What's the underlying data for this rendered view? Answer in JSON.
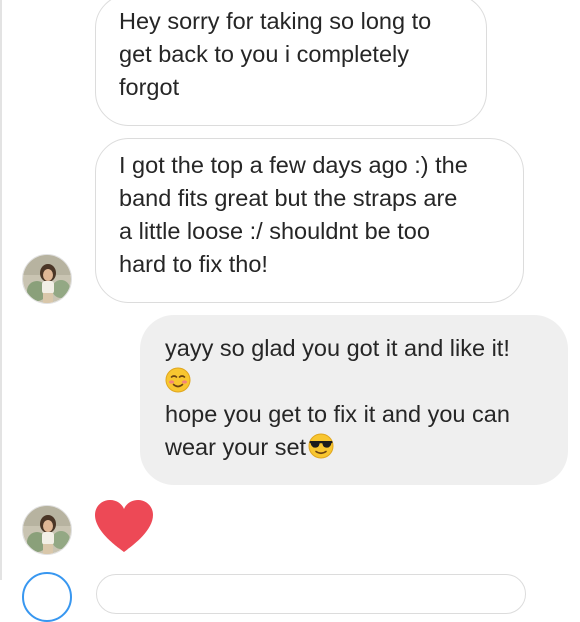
{
  "thread": {
    "messages": [
      {
        "direction": "incoming",
        "lines": [
          "Hey sorry for taking so long to",
          "get back to you i completely",
          "forgot"
        ]
      },
      {
        "direction": "incoming",
        "lines": [
          "I got the top a few days ago :) the",
          "band fits great but the straps are",
          "a little loose :/ shouldnt be too",
          "hard to fix tho!"
        ]
      },
      {
        "direction": "outgoing",
        "lines": [
          "yayy so glad you got it and like it!",
          "",
          "hope you get to fix it and you can",
          "wear your set"
        ],
        "emojis": [
          "smiling-blush-emoji",
          "sunglasses-emoji"
        ]
      },
      {
        "direction": "incoming",
        "type": "reaction",
        "icon": "heart-icon"
      }
    ]
  },
  "colors": {
    "heart": "#ed4956",
    "outgoing_bubble": "#efefef",
    "incoming_border": "#dcdcdc",
    "text": "#262626",
    "emoji_face": "#f8c630"
  }
}
